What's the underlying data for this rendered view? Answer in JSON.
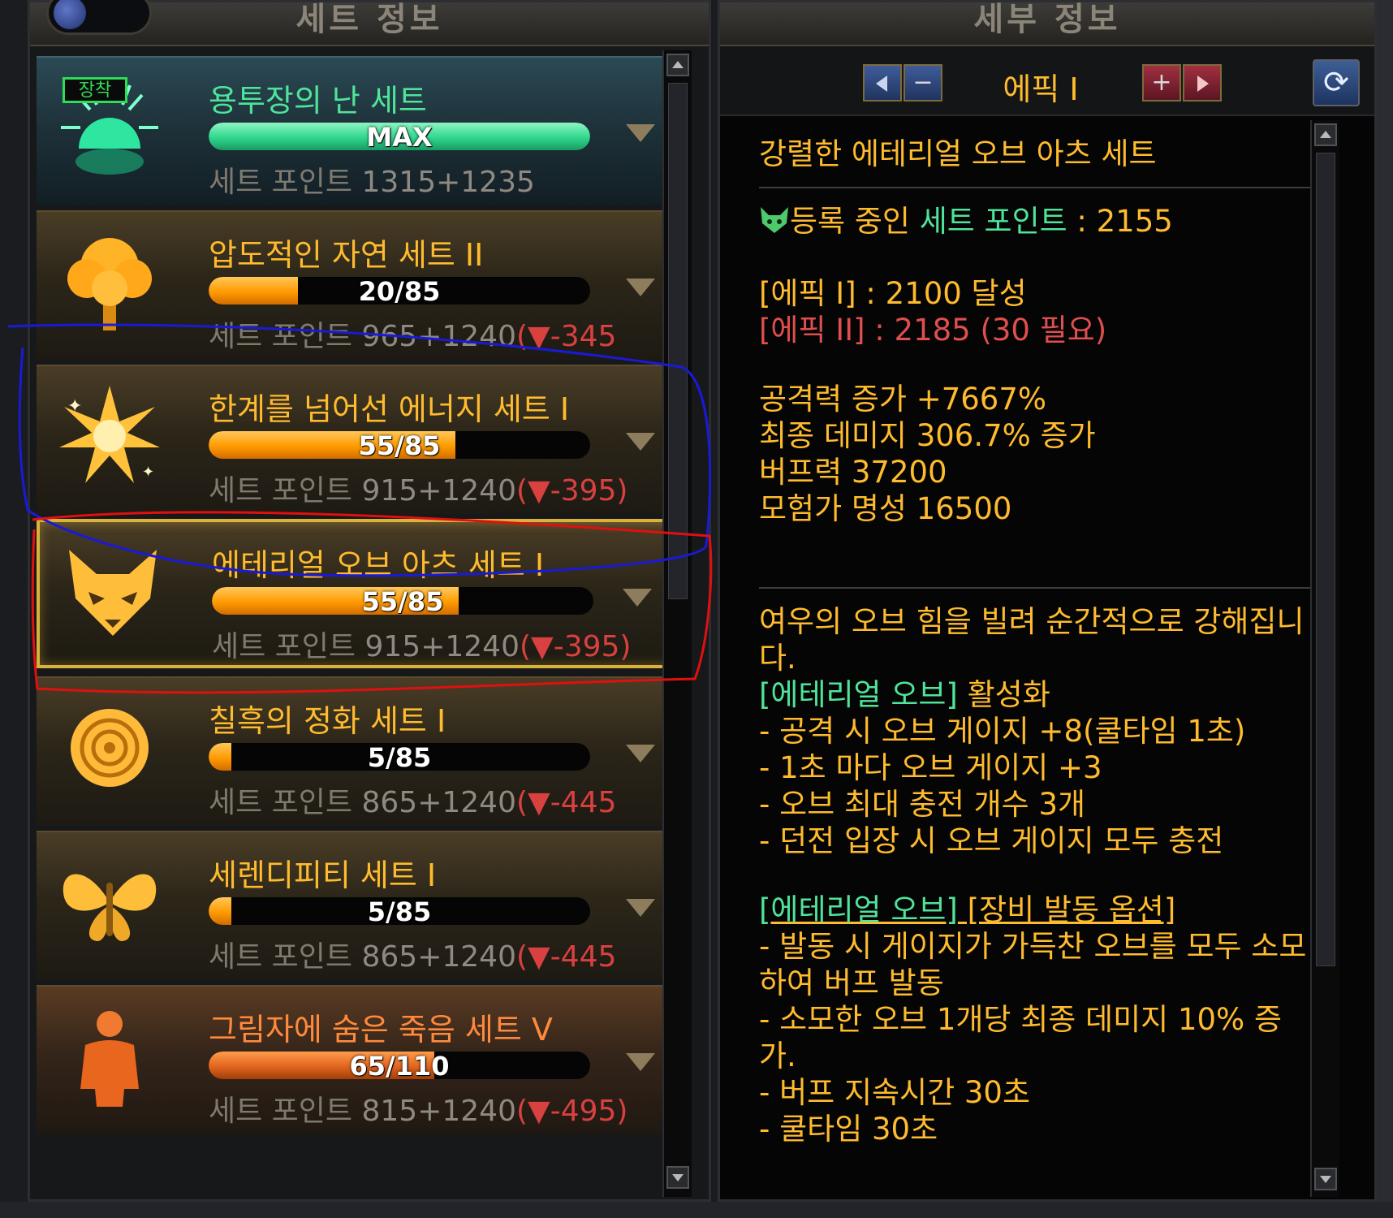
{
  "left_panel": {
    "title": "세트 정보",
    "sets": [
      {
        "name": "용투장의 난 세트",
        "bar_text": "MAX",
        "progress": 1.0,
        "points_label": "세트 포인트",
        "points_value": "1315+1235",
        "delta": "",
        "badge": "장착",
        "style": "equipped",
        "icon": "sunrise-icon"
      },
      {
        "name": "압도적인 자연 세트 II",
        "bar_text": "20/85",
        "progress": 0.235,
        "points_label": "세트 포인트",
        "points_value": "965+1240",
        "delta": "(▼-345",
        "style": "normal",
        "icon": "tree-icon"
      },
      {
        "name": "한계를 넘어선 에너지 세트 I",
        "bar_text": "55/85",
        "progress": 0.647,
        "points_label": "세트 포인트",
        "points_value": "915+1240",
        "delta": "(▼-395)",
        "style": "normal",
        "icon": "energy-burst-icon"
      },
      {
        "name": "에테리얼 오브 아츠 세트 I",
        "bar_text": "55/85",
        "progress": 0.647,
        "points_label": "세트 포인트",
        "points_value": "915+1240",
        "delta": "(▼-395)",
        "style": "selected",
        "icon": "fox-icon"
      },
      {
        "name": "칠흑의 정화 세트 I",
        "bar_text": "5/85",
        "progress": 0.059,
        "points_label": "세트 포인트",
        "points_value": "865+1240",
        "delta": "(▼-445",
        "style": "normal",
        "icon": "rose-icon"
      },
      {
        "name": "세렌디피티 세트 I",
        "bar_text": "5/85",
        "progress": 0.059,
        "points_label": "세트 포인트",
        "points_value": "865+1240",
        "delta": "(▼-445",
        "style": "normal",
        "icon": "butterfly-icon"
      },
      {
        "name": "그림자에 숨은 죽음 세트 V",
        "bar_text": "65/110",
        "progress": 0.591,
        "points_label": "세트 포인트",
        "points_value": "815+1240",
        "delta": "(▼-495)",
        "style": "shadow",
        "icon": "shadow-figure-icon"
      }
    ]
  },
  "right_panel": {
    "title": "세부 정보",
    "grade_label": "에픽 I",
    "set_title": "강렬한 에테리얼 오브 아츠 세트",
    "registered_prefix": "등록 중인 ",
    "registered_highlight": "세트 포인트",
    "registered_suffix": " : 2155",
    "tier1": "[에픽 I] : 2100 달성",
    "tier2": "[에픽 II] : 2185 (30 필요)",
    "stats": [
      "공격력 증가 +7667%",
      "최종 데미지 306.7% 증가",
      "버프력 37200",
      "모험가 명성 16500"
    ],
    "desc_intro": "여우의 오브 힘을 빌려 순간적으로 강해집니다.",
    "orb_tag": "[에테리얼 오브]",
    "orb_suffix": " 활성화",
    "orb_lines": [
      "- 공격 시 오브 게이지 +8(쿨타임 1초)",
      "- 1초 마다 오브 게이지 +3",
      "- 오브 최대 충전 개수 3개",
      "- 던전 입장 시 오브 게이지 모두 충전"
    ],
    "option_tag": "[에테리얼 오브]",
    "option_suffix": " [장비 발동 옵션]",
    "option_lines": [
      "- 발동 시 게이지가 가득찬 오브를 모두 소모하여 버프 발동",
      "- 소모한 오브 1개당 최종 데미지 10% 증가.",
      "- 버프 지속시간 30초",
      "- 쿨타임 30초"
    ]
  },
  "colors": {
    "gold": "#ffbb2e",
    "green": "#4ee49a",
    "red": "#e04e4e",
    "selected_border": "#d8b23a",
    "annotation_blue": "#1a1ad6",
    "annotation_red": "#e01010"
  }
}
